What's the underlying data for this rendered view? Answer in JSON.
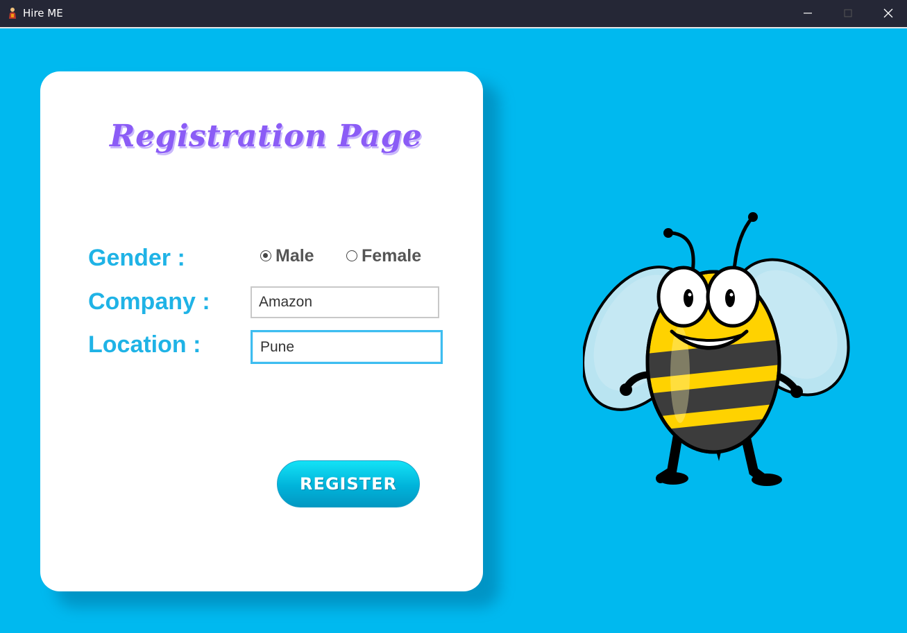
{
  "window": {
    "title": "Hire ME",
    "icon": "app-person-icon",
    "controls": [
      "minimize-icon",
      "maximize-icon",
      "close-icon"
    ]
  },
  "form": {
    "heading": "Registration Page",
    "gender": {
      "label": "Gender :",
      "options": [
        {
          "label": "Male",
          "selected": true
        },
        {
          "label": "Female",
          "selected": false
        }
      ]
    },
    "company": {
      "label": "Company :",
      "value": "Amazon"
    },
    "location": {
      "label": "Location :",
      "value": "Pune"
    },
    "register_label": "REGISTER"
  },
  "illustration": {
    "icon": "cartoon-bee-illustration"
  },
  "colors": {
    "background": "#00b9ef",
    "card": "#ffffff",
    "heading": "#8b5cf6",
    "label": "#1fb3e6",
    "button": "#00b3da",
    "titlebar": "#252736"
  }
}
